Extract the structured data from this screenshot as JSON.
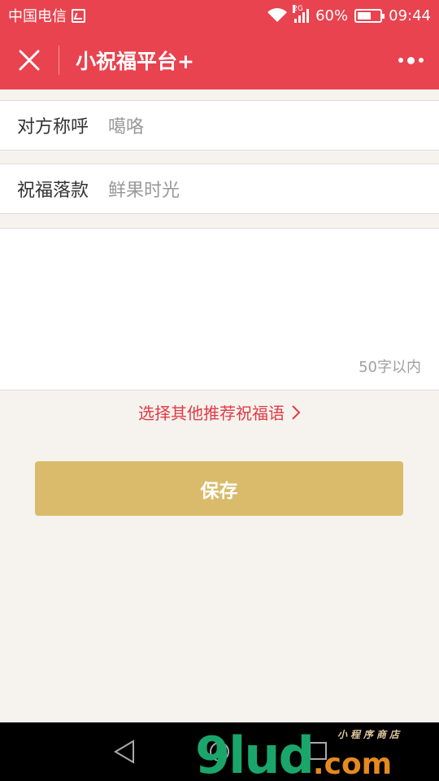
{
  "status_bar": {
    "carrier": "中国电信",
    "network_tag": "2G",
    "battery_percent": "60%",
    "battery_level": 0.6,
    "time": "09:44"
  },
  "title_bar": {
    "title": "小祝福平台+",
    "close_icon": "close-icon",
    "more_icon": "more-dots-icon"
  },
  "form": {
    "recipient": {
      "label": "对方称呼",
      "value": "噶咯"
    },
    "signature": {
      "label": "祝福落款",
      "value": "鲜果时光"
    },
    "message": {
      "value": "",
      "limit_hint": "50字以内"
    }
  },
  "recommend_link": "选择其他推荐祝福语",
  "save_label": "保存",
  "watermark": {
    "main": "9lud",
    "suffix": ".com",
    "small": "小程序商店"
  },
  "colors": {
    "header": "#e8434f",
    "accent_text": "#e03a46",
    "save_button": "#d9bb6b",
    "background": "#f6f3ee"
  }
}
